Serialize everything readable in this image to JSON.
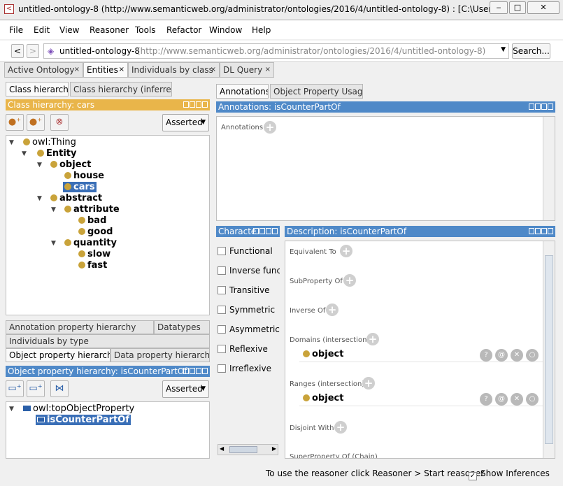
{
  "window": {
    "title": "untitled-ontology-8 (http://www.semanticweb.org/administrator/ontologies/2016/4/untitled-ontology-8)  : [C:\\Users\\Ad..."
  },
  "menu": [
    "File",
    "Edit",
    "View",
    "Reasoner",
    "Tools",
    "Refactor",
    "Window",
    "Help"
  ],
  "address": {
    "back": "<",
    "forward": ">",
    "ontology_name": "untitled-ontology-8",
    "ontology_iri": "(http://www.semanticweb.org/administrator/ontologies/2016/4/untitled-ontology-8)",
    "search": "Search..."
  },
  "main_tabs": [
    {
      "label": "Active Ontology"
    },
    {
      "label": "Entities"
    },
    {
      "label": "Individuals by class"
    },
    {
      "label": "DL Query"
    }
  ],
  "left": {
    "class_tabs": [
      "Class hierarchy",
      "Class hierarchy (inferred)"
    ],
    "class_header": "Class hierarchy: cars",
    "asserted": "Asserted",
    "class_tree": [
      "owl:Thing",
      "Entity",
      "object",
      "house",
      "cars",
      "abstract",
      "attribute",
      "bad",
      "good",
      "quantity",
      "slow",
      "fast"
    ],
    "lower_tabs": [
      "Annotation property hierarchy",
      "Datatypes",
      "Individuals by type",
      "Object property hierarchy",
      "Data property hierarchy"
    ],
    "obj_header": "Object property hierarchy: isCounterPartOf",
    "obj_asserted": "Asserted",
    "obj_tree": [
      "owl:topObjectProperty",
      "isCounterPartOf"
    ]
  },
  "right": {
    "tabs": [
      "Annotations",
      "Object Property Usage"
    ],
    "annot_header": "Annotations: isCounterPartOf",
    "annot_label": "Annotations",
    "char_header": "Characte",
    "characteristics": [
      "Functional",
      "Inverse functi",
      "Transitive",
      "Symmetric",
      "Asymmetric",
      "Reflexive",
      "Irreflexive"
    ],
    "desc_header": "Description: isCounterPartOf",
    "desc_sections": {
      "equiv": "Equivalent To",
      "subprop": "SubProperty Of",
      "inverse": "Inverse Of",
      "domains": "Domains (intersection)",
      "domain_val": "object",
      "ranges": "Ranges (intersection)",
      "range_val": "object",
      "disjoint": "Disjoint With",
      "chain": "SuperProperty Of (Chain)"
    }
  },
  "status": {
    "message": "To use the reasoner click Reasoner > Start reasoner",
    "show_inferences": "Show Inferences"
  }
}
